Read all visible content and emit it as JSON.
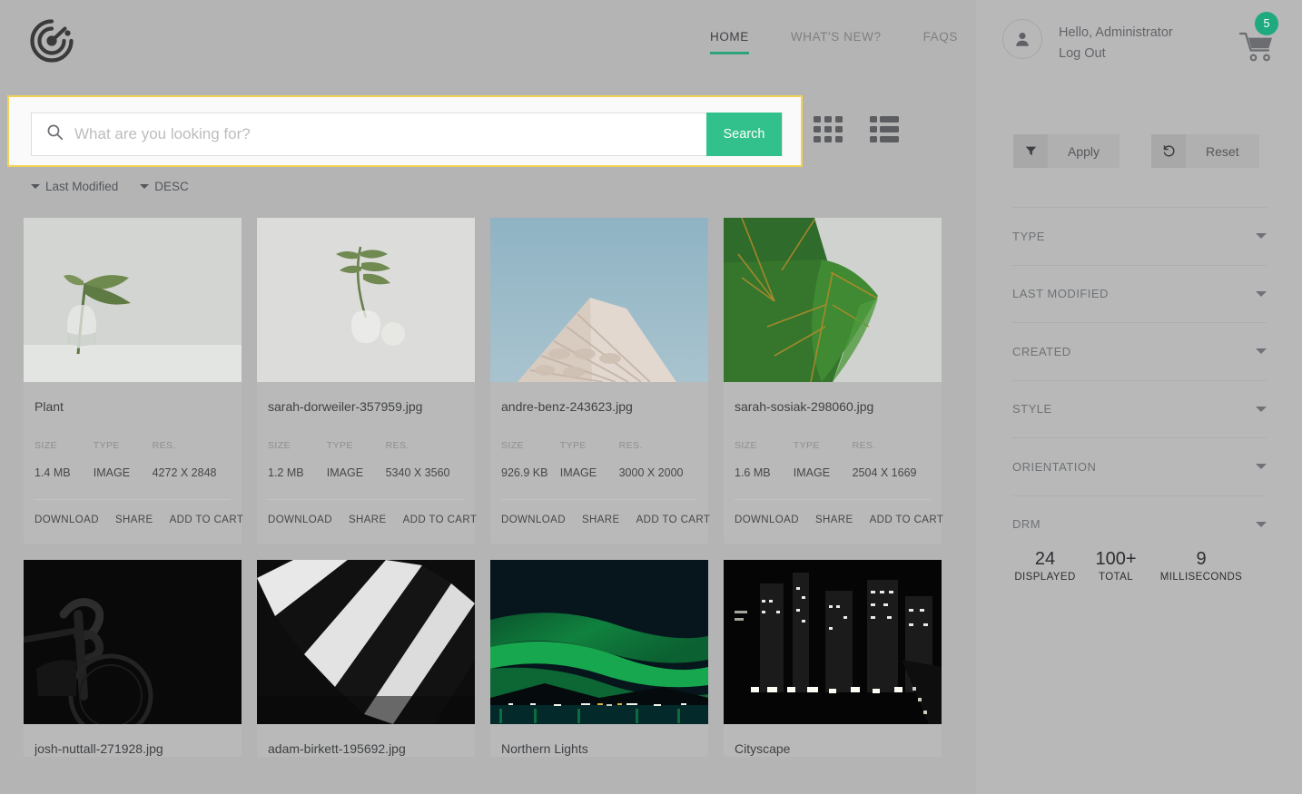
{
  "brand": {
    "logo_icon": "radar-target-logo"
  },
  "nav": {
    "items": [
      {
        "label": "HOME",
        "active": true
      },
      {
        "label": "WHAT'S NEW?",
        "active": false
      },
      {
        "label": "FAQS",
        "active": false
      }
    ],
    "active_accent": "#2ea37a"
  },
  "user": {
    "avatar_icon": "user-avatar-icon",
    "greeting": "Hello, Administrator",
    "logout_label": "Log Out",
    "cart_icon": "shopping-cart-icon",
    "cart_count": "5",
    "cart_badge_color": "#1fa97e"
  },
  "search": {
    "icon": "search-icon",
    "value": "",
    "placeholder": "What are you looking for?",
    "button_label": "Search",
    "button_color": "#32c08c",
    "focus_outline_color": "#f2d257"
  },
  "view": {
    "grid_icon": "grid-view-icon",
    "list_icon": "list-view-icon"
  },
  "sort": {
    "field_label": "Last Modified",
    "direction_label": "DESC"
  },
  "card_meta_labels": {
    "size": "SIZE",
    "type": "TYPE",
    "resolution": "RES."
  },
  "card_actions": [
    "DOWNLOAD",
    "SHARE",
    "ADD TO CART"
  ],
  "assets": [
    {
      "title": "Plant",
      "size": "1.4 MB",
      "type": "IMAGE",
      "resolution": "4272 X 2848",
      "thumb": "plant-in-glass-vase"
    },
    {
      "title": "sarah-dorweiler-357959.jpg",
      "size": "1.2 MB",
      "type": "IMAGE",
      "resolution": "5340 X 3560",
      "thumb": "palm-leaf-in-glass"
    },
    {
      "title": "andre-benz-243623.jpg",
      "size": "926.9 KB",
      "type": "IMAGE",
      "resolution": "3000 X 2000",
      "thumb": "white-building-blue-sky"
    },
    {
      "title": "sarah-sosiak-298060.jpg",
      "size": "1.6 MB",
      "type": "IMAGE",
      "resolution": "2504 X 1669",
      "thumb": "green-fiddle-leaf"
    },
    {
      "title": "josh-nuttall-271928.jpg",
      "size": "",
      "type": "",
      "resolution": "",
      "thumb": "dark-bicycle-handlebars"
    },
    {
      "title": "adam-birkett-195692.jpg",
      "size": "",
      "type": "",
      "resolution": "",
      "thumb": "striped-awning-bw"
    },
    {
      "title": "Northern Lights",
      "size": "",
      "type": "",
      "resolution": "",
      "thumb": "aurora-over-water"
    },
    {
      "title": "Cityscape",
      "size": "",
      "type": "",
      "resolution": "",
      "thumb": "night-cityscape"
    }
  ],
  "filters": {
    "apply": {
      "label": "Apply",
      "icon": "funnel-filter-icon"
    },
    "reset": {
      "label": "Reset",
      "icon": "reset-undo-icon"
    },
    "sections": [
      {
        "label": "TYPE",
        "icon": "chevron-down-icon"
      },
      {
        "label": "LAST MODIFIED",
        "icon": "chevron-down-icon"
      },
      {
        "label": "CREATED",
        "icon": "chevron-down-icon"
      },
      {
        "label": "STYLE",
        "icon": "chevron-down-icon"
      },
      {
        "label": "ORIENTATION",
        "icon": "chevron-down-icon"
      },
      {
        "label": "DRM",
        "icon": "chevron-down-icon"
      }
    ]
  },
  "stats": [
    {
      "value": "24",
      "label": "DISPLAYED"
    },
    {
      "value": "100+",
      "label": "TOTAL"
    },
    {
      "value": "9",
      "label": "MILLISECONDS"
    }
  ]
}
